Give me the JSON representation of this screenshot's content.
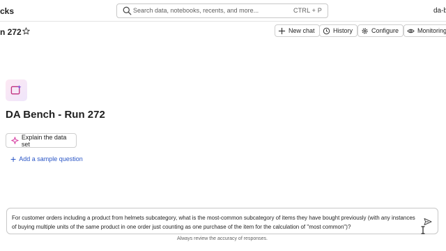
{
  "topbar": {
    "app_fragment": "cks",
    "search_placeholder": "Search data, notebooks, recents, and more...",
    "search_shortcut": "CTRL + P",
    "user_fragment": "da-b"
  },
  "header": {
    "run_title": "n 272",
    "buttons": {
      "new_chat": "New chat",
      "history": "History",
      "configure": "Configure",
      "monitoring": "Monitoring"
    }
  },
  "main": {
    "title": "DA Bench - Run 272",
    "explain_label": "Explain the data set",
    "add_sample_label": "Add a sample question"
  },
  "chat": {
    "input_text": "For customer orders including a product from helmets subcategory, what is the most-common subcategory of items they have bought previously (with any instances of buying multiple units of the same product in one order just counting as one purchase of the item for the calculation of \"most common\")?",
    "disclaimer": "Always review the accuracy of responses."
  },
  "colors": {
    "accent_link": "#2a56c6",
    "sparkle_pink": "#d63aa0",
    "logo_gradient": [
      "#fde8f3",
      "#efe6fb"
    ]
  },
  "icons": [
    "search-icon",
    "star-icon",
    "plus-icon",
    "history-icon",
    "gear-icon",
    "eye-icon",
    "sparkle-icon",
    "send-icon",
    "text-cursor-icon"
  ]
}
